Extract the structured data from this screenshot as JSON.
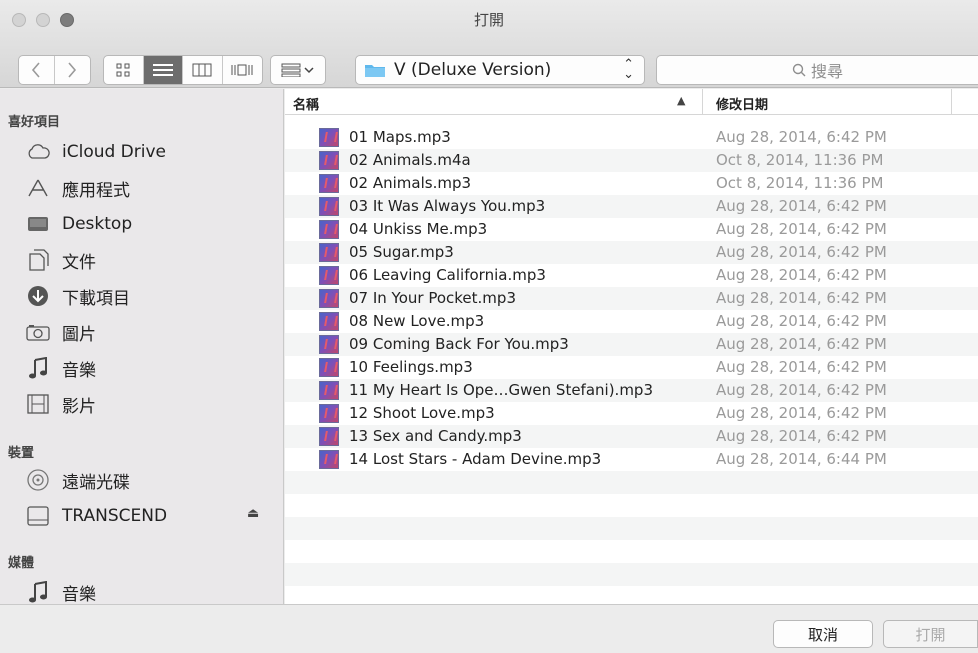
{
  "window": {
    "title": "打開"
  },
  "toolbar": {
    "path_label": "V (Deluxe Version)",
    "search_placeholder": "搜尋"
  },
  "sidebar": {
    "sections": [
      {
        "header": "喜好項目",
        "items": [
          {
            "label": "iCloud Drive",
            "icon": "cloud-icon"
          },
          {
            "label": "應用程式",
            "icon": "applications-icon"
          },
          {
            "label": "Desktop",
            "icon": "desktop-icon"
          },
          {
            "label": "文件",
            "icon": "documents-icon"
          },
          {
            "label": "下載項目",
            "icon": "downloads-icon"
          },
          {
            "label": "圖片",
            "icon": "camera-icon"
          },
          {
            "label": "音樂",
            "icon": "music-note-icon"
          },
          {
            "label": "影片",
            "icon": "film-icon"
          }
        ]
      },
      {
        "header": "裝置",
        "items": [
          {
            "label": "遠端光碟",
            "icon": "disc-icon"
          },
          {
            "label": "TRANSCEND",
            "icon": "drive-icon"
          }
        ]
      },
      {
        "header": "媒體",
        "items": [
          {
            "label": "音樂",
            "icon": "music-note-icon"
          }
        ]
      }
    ]
  },
  "list": {
    "columns": {
      "name": "名稱",
      "date": "修改日期"
    },
    "files": [
      {
        "name": "01 Maps.mp3",
        "date": "Aug 28, 2014, 6:42 PM"
      },
      {
        "name": "02 Animals.m4a",
        "date": "Oct 8, 2014, 11:36 PM"
      },
      {
        "name": "02 Animals.mp3",
        "date": "Oct 8, 2014, 11:36 PM"
      },
      {
        "name": "03 It Was Always You.mp3",
        "date": "Aug 28, 2014, 6:42 PM"
      },
      {
        "name": "04 Unkiss Me.mp3",
        "date": "Aug 28, 2014, 6:42 PM"
      },
      {
        "name": "05 Sugar.mp3",
        "date": "Aug 28, 2014, 6:42 PM"
      },
      {
        "name": "06 Leaving California.mp3",
        "date": "Aug 28, 2014, 6:42 PM"
      },
      {
        "name": "07 In Your Pocket.mp3",
        "date": "Aug 28, 2014, 6:42 PM"
      },
      {
        "name": "08 New Love.mp3",
        "date": "Aug 28, 2014, 6:42 PM"
      },
      {
        "name": "09 Coming Back For You.mp3",
        "date": "Aug 28, 2014, 6:42 PM"
      },
      {
        "name": "10 Feelings.mp3",
        "date": "Aug 28, 2014, 6:42 PM"
      },
      {
        "name": "11 My Heart Is Ope…Gwen Stefani).mp3",
        "date": "Aug 28, 2014, 6:42 PM"
      },
      {
        "name": "12 Shoot Love.mp3",
        "date": "Aug 28, 2014, 6:42 PM"
      },
      {
        "name": "13 Sex and Candy.mp3",
        "date": "Aug 28, 2014, 6:42 PM"
      },
      {
        "name": "14 Lost Stars - Adam Devine.mp3",
        "date": "Aug 28, 2014, 6:44 PM"
      }
    ]
  },
  "buttons": {
    "cancel": "取消",
    "open": "打開"
  }
}
